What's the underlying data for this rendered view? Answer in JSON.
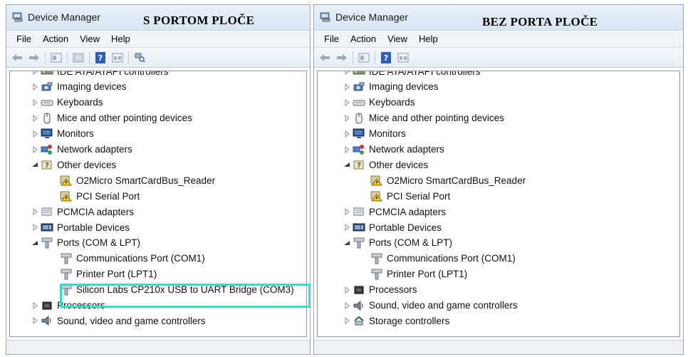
{
  "left_window": {
    "title": "Device Manager",
    "caption": "S PORTOM PLOČE",
    "menu": [
      "File",
      "Action",
      "View",
      "Help"
    ],
    "tree": [
      {
        "label": "IDE ATA/ATAPI controllers",
        "level": 0,
        "expander": "collapsed",
        "icon": "ide-controller-icon"
      },
      {
        "label": "Imaging devices",
        "level": 0,
        "expander": "collapsed",
        "icon": "camera-icon"
      },
      {
        "label": "Keyboards",
        "level": 0,
        "expander": "collapsed",
        "icon": "keyboard-icon"
      },
      {
        "label": "Mice and other pointing devices",
        "level": 0,
        "expander": "collapsed",
        "icon": "mouse-icon"
      },
      {
        "label": "Monitors",
        "level": 0,
        "expander": "collapsed",
        "icon": "monitor-icon"
      },
      {
        "label": "Network adapters",
        "level": 0,
        "expander": "collapsed",
        "icon": "network-icon"
      },
      {
        "label": "Other devices",
        "level": 0,
        "expander": "expanded",
        "icon": "unknown-device-icon"
      },
      {
        "label": "O2Micro SmartCardBus_Reader",
        "level": 1,
        "expander": "none",
        "icon": "warning-device-icon"
      },
      {
        "label": "PCI Serial Port",
        "level": 1,
        "expander": "none",
        "icon": "warning-device-icon"
      },
      {
        "label": "PCMCIA adapters",
        "level": 0,
        "expander": "collapsed",
        "icon": "pcmcia-icon"
      },
      {
        "label": "Portable Devices",
        "level": 0,
        "expander": "collapsed",
        "icon": "portable-device-icon"
      },
      {
        "label": "Ports (COM & LPT)",
        "level": 0,
        "expander": "expanded",
        "icon": "port-icon"
      },
      {
        "label": "Communications Port (COM1)",
        "level": 1,
        "expander": "none",
        "icon": "port-icon"
      },
      {
        "label": "Printer Port (LPT1)",
        "level": 1,
        "expander": "none",
        "icon": "port-icon"
      },
      {
        "label": "Silicon Labs CP210x USB to UART Bridge (COM3)",
        "level": 1,
        "expander": "none",
        "icon": "port-icon"
      },
      {
        "label": "Processors",
        "level": 0,
        "expander": "collapsed",
        "icon": "processor-icon"
      },
      {
        "label": "Sound, video and game controllers",
        "level": 0,
        "expander": "collapsed",
        "icon": "sound-icon"
      }
    ],
    "highlight_color": "#2ee0c7"
  },
  "right_window": {
    "title": "Device Manager",
    "caption": "BEZ PORTA PLOČE",
    "menu": [
      "File",
      "Action",
      "View",
      "Help"
    ],
    "tree": [
      {
        "label": "IDE ATA/ATAPI controllers",
        "level": 0,
        "expander": "collapsed",
        "icon": "ide-controller-icon"
      },
      {
        "label": "Imaging devices",
        "level": 0,
        "expander": "collapsed",
        "icon": "camera-icon"
      },
      {
        "label": "Keyboards",
        "level": 0,
        "expander": "collapsed",
        "icon": "keyboard-icon"
      },
      {
        "label": "Mice and other pointing devices",
        "level": 0,
        "expander": "collapsed",
        "icon": "mouse-icon"
      },
      {
        "label": "Monitors",
        "level": 0,
        "expander": "collapsed",
        "icon": "monitor-icon"
      },
      {
        "label": "Network adapters",
        "level": 0,
        "expander": "collapsed",
        "icon": "network-icon"
      },
      {
        "label": "Other devices",
        "level": 0,
        "expander": "expanded",
        "icon": "unknown-device-icon"
      },
      {
        "label": "O2Micro SmartCardBus_Reader",
        "level": 1,
        "expander": "none",
        "icon": "warning-device-icon"
      },
      {
        "label": "PCI Serial Port",
        "level": 1,
        "expander": "none",
        "icon": "warning-device-icon"
      },
      {
        "label": "PCMCIA adapters",
        "level": 0,
        "expander": "collapsed",
        "icon": "pcmcia-icon"
      },
      {
        "label": "Portable Devices",
        "level": 0,
        "expander": "collapsed",
        "icon": "portable-device-icon"
      },
      {
        "label": "Ports (COM & LPT)",
        "level": 0,
        "expander": "expanded",
        "icon": "port-icon"
      },
      {
        "label": "Communications Port (COM1)",
        "level": 1,
        "expander": "none",
        "icon": "port-icon"
      },
      {
        "label": "Printer Port (LPT1)",
        "level": 1,
        "expander": "none",
        "icon": "port-icon"
      },
      {
        "label": "Processors",
        "level": 0,
        "expander": "collapsed",
        "icon": "processor-icon"
      },
      {
        "label": "Sound, video and game controllers",
        "level": 0,
        "expander": "collapsed",
        "icon": "sound-icon"
      },
      {
        "label": "Storage controllers",
        "level": 0,
        "expander": "collapsed",
        "icon": "storage-icon"
      }
    ]
  },
  "toolbar_icons": [
    "back-arrow-icon",
    "forward-arrow-icon",
    "properties-icon",
    "update-driver-icon",
    "help-icon",
    "view-icon",
    "scan-hardware-icon"
  ]
}
